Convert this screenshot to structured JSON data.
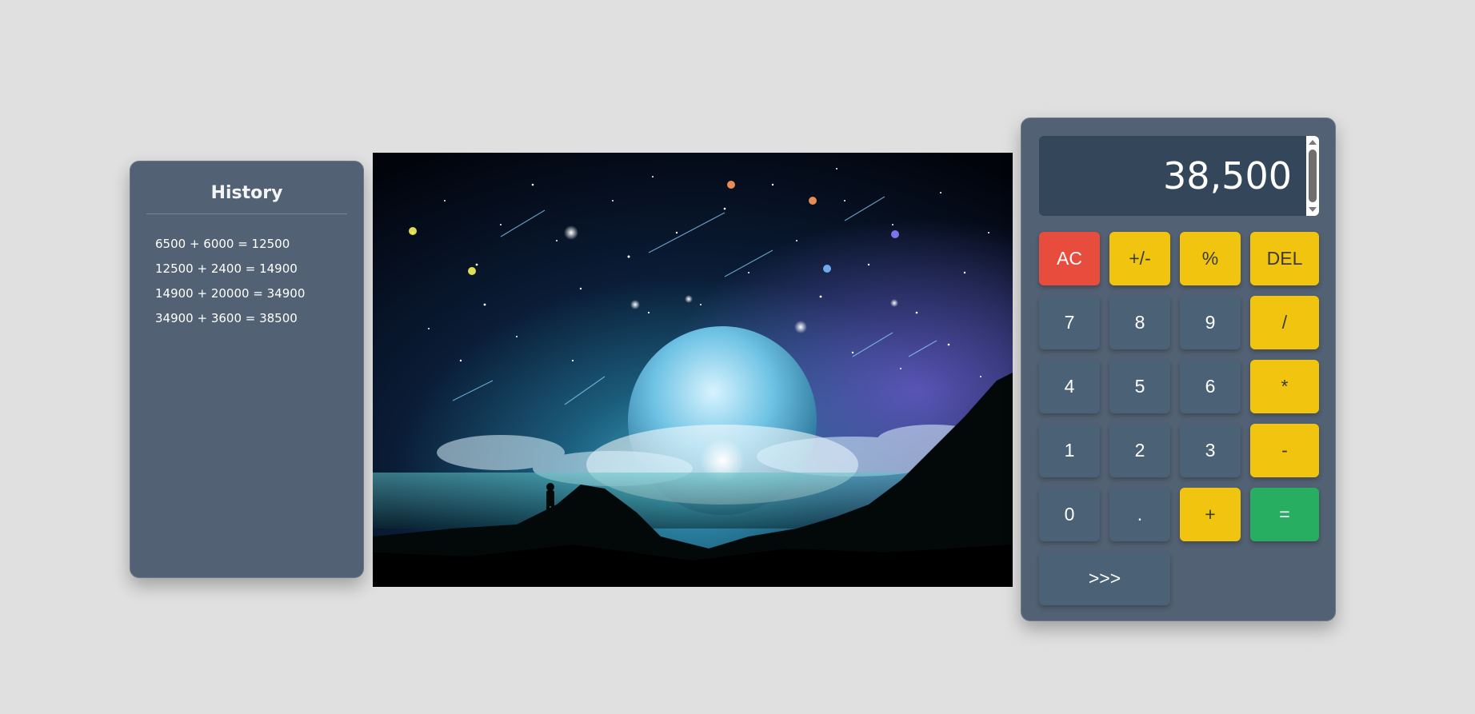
{
  "history": {
    "title": "History",
    "entries": [
      "6500 + 6000 = 12500",
      "12500 + 2400 = 14900",
      "14900 + 20000 = 34900",
      "34900 + 3600 = 38500"
    ]
  },
  "calculator": {
    "display_value": "38,500",
    "keys": {
      "ac": "AC",
      "plus_minus": "+/-",
      "percent": "%",
      "del": "DEL",
      "seven": "7",
      "eight": "8",
      "nine": "9",
      "divide": "/",
      "four": "4",
      "five": "5",
      "six": "6",
      "multiply": "*",
      "one": "1",
      "two": "2",
      "three": "3",
      "minus": "-",
      "zero": "0",
      "decimal": ".",
      "plus": "+",
      "equals": "=",
      "toggle_history": ">>>"
    }
  },
  "colors": {
    "background": "#e0e0e0",
    "panel": "#526173",
    "display": "#34475a",
    "number_key": "#4b6276",
    "operator_key": "#f1c40f",
    "clear_key": "#e74c3c",
    "equals_key": "#27ae60"
  }
}
